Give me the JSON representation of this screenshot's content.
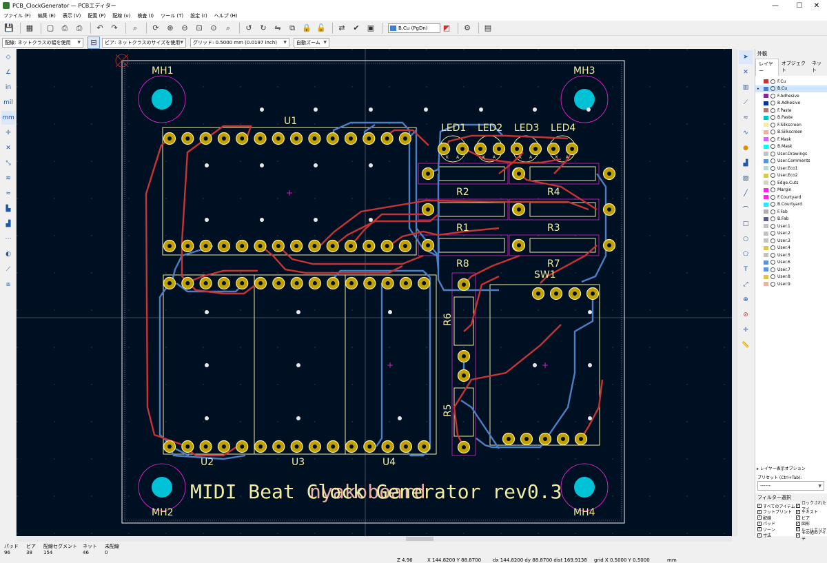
{
  "window": {
    "title": "PCB_ClockGenerator — PCBエディター",
    "controls": [
      "—",
      "☐",
      "✕"
    ]
  },
  "menu": [
    "ファイル (F)",
    "編集 (E)",
    "表示 (V)",
    "配置 (P)",
    "配線 (u)",
    "検査 (I)",
    "ツール (T)",
    "設定 (r)",
    "ヘルプ (H)"
  ],
  "toolbar": {
    "active_layer": "B.Cu (PgDn)"
  },
  "options": {
    "track": "配線: ネットクラスの幅を使用",
    "via": "ビア: ネットクラスのサイズを使用",
    "grid": "グリッド: 0.5000 mm (0.0197 inch)",
    "zoom": "自動ズーム"
  },
  "board": {
    "title_text": "MIDI Beat Clock Generator rev0.3",
    "overlay_text": "nyakoboard",
    "refs": {
      "U1": "U1",
      "U2": "U2",
      "U3": "U3",
      "U4": "U4",
      "MH1": "MH1",
      "MH2": "MH2",
      "MH3": "MH3",
      "MH4": "MH4",
      "R1": "R1",
      "R2": "R2",
      "R3": "R3",
      "R4": "R4",
      "R5": "R5",
      "R6": "R6",
      "R7": "R7",
      "R8": "R8",
      "SW1": "SW1",
      "LED1": "LED1",
      "LED2": "LED2",
      "LED3": "LED3",
      "LED4": "LED4",
      "K": "K",
      "A": "A"
    },
    "colors": {
      "bg": "#001023",
      "fcu": "#c83434",
      "bcu": "#4d7fc4",
      "silk": "#f2eda1",
      "pad": "#c2a000",
      "edge": "#d0d2cd",
      "courtyard": "#ff26e2"
    }
  },
  "panel": {
    "header": "外観",
    "tabs": [
      "レイヤー",
      "オブジェクト",
      "ネット"
    ],
    "layers": [
      {
        "name": "F.Cu",
        "color": "#c83434"
      },
      {
        "name": "B.Cu",
        "color": "#4d7fc4"
      },
      {
        "name": "F.Adhesive",
        "color": "#842b8c"
      },
      {
        "name": "B.Adhesive",
        "color": "#0033a0"
      },
      {
        "name": "F.Paste",
        "color": "#b47070"
      },
      {
        "name": "B.Paste",
        "color": "#00c2c2"
      },
      {
        "name": "F.Silkscreen",
        "color": "#f2eda1"
      },
      {
        "name": "B.Silkscreen",
        "color": "#e8b2a7"
      },
      {
        "name": "F.Mask",
        "color": "#d864ff"
      },
      {
        "name": "B.Mask",
        "color": "#02ffee"
      },
      {
        "name": "User.Drawings",
        "color": "#c2c2c2"
      },
      {
        "name": "User.Comments",
        "color": "#5994dc"
      },
      {
        "name": "User.Eco1",
        "color": "#b4dbd2"
      },
      {
        "name": "User.Eco2",
        "color": "#d8c852"
      },
      {
        "name": "Edge.Cuts",
        "color": "#d0d2cd"
      },
      {
        "name": "Margin",
        "color": "#ff26e2"
      },
      {
        "name": "F.Courtyard",
        "color": "#ff26e2"
      },
      {
        "name": "B.Courtyard",
        "color": "#26e9ff"
      },
      {
        "name": "F.Fab",
        "color": "#afafaf"
      },
      {
        "name": "B.Fab",
        "color": "#585d84"
      },
      {
        "name": "User.1",
        "color": "#c2c2c2"
      },
      {
        "name": "User.2",
        "color": "#c2c2c2"
      },
      {
        "name": "User.3",
        "color": "#c2c2c2"
      },
      {
        "name": "User.4",
        "color": "#d8c852"
      },
      {
        "name": "User.5",
        "color": "#c2c2c2"
      },
      {
        "name": "User.6",
        "color": "#5994dc"
      },
      {
        "name": "User.7",
        "color": "#5994dc"
      },
      {
        "name": "User.8",
        "color": "#d8c852"
      },
      {
        "name": "User.9",
        "color": "#e8b2a7"
      }
    ],
    "display_options": "▸ レイヤー表示オプション",
    "preset_label": "プリセット (Ctrl+Tab):",
    "preset_value": "------",
    "filter_title": "フィルター選択",
    "filters": [
      "すべてのアイテム",
      "ロックされたアイ",
      "フットプリント",
      "テキスト",
      "配線",
      "ビア",
      "パッド",
      "図形",
      "ゾーン",
      "ルールエリア",
      "寸法",
      "その他のアイテ"
    ]
  },
  "status": {
    "labels": [
      "パッド",
      "ビア",
      "配線セグメント",
      "ネット",
      "未配線"
    ],
    "values": [
      "96",
      "38",
      "154",
      "46",
      "0"
    ],
    "z": "Z 4.96",
    "xy": "X 144.8200  Y 88.8700",
    "dxy": "dx 144.8200  dy 88.8700  dist 169.9138",
    "grid": "grid X 0.5000  Y 0.5000",
    "units": "mm"
  }
}
